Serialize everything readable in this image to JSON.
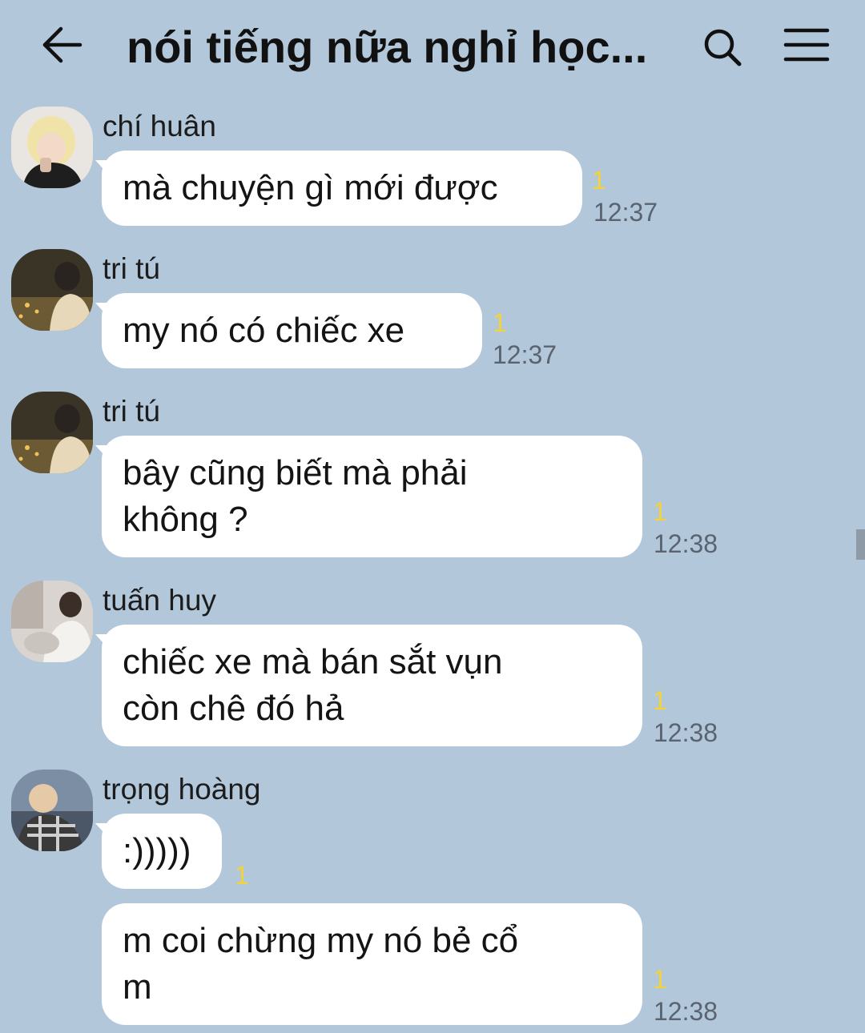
{
  "header": {
    "title": "nói tiếng nữa nghỉ học...",
    "back_icon": "arrow-left-icon",
    "search_icon": "search-icon",
    "menu_icon": "hamburger-menu-icon"
  },
  "colors": {
    "background": "#b2c7da",
    "bubble": "#ffffff",
    "unread": "#f3d33a",
    "time": "#5a6470"
  },
  "messages": [
    {
      "sender": "chí huân",
      "text": "mà chuyện gì mới được",
      "unread": "1",
      "time": "12:37"
    },
    {
      "sender": "tri tú",
      "text": "my nó có chiếc xe",
      "unread": "1",
      "time": "12:37"
    },
    {
      "sender": "tri tú",
      "text": "bây cũng biết mà phải\nkhông ?",
      "unread": "1",
      "time": "12:38"
    },
    {
      "sender": "tuấn huy",
      "text": "chiếc xe mà bán sắt vụn\ncòn chê đó hả",
      "unread": "1",
      "time": "12:38"
    },
    {
      "sender": "trọng hoàng",
      "text": ":)))))",
      "unread": "1",
      "time": ""
    },
    {
      "sender": "",
      "text": "m coi chừng my nó bẻ cổ\nm",
      "unread": "1",
      "time": "12:38"
    }
  ]
}
